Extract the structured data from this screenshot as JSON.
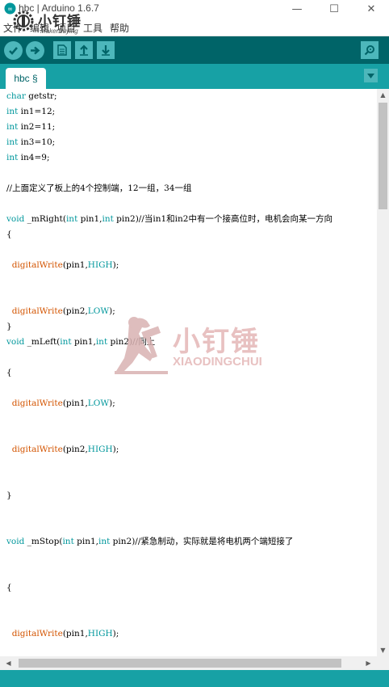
{
  "window": {
    "title": "hbc | Arduino 1.6.7",
    "minimize": "—",
    "maximize": "☐",
    "close": "✕"
  },
  "menu": [
    "文件",
    "编辑",
    "项目",
    "工具",
    "帮助"
  ],
  "logo": {
    "text": "小钉锤",
    "subtitle": "MakerBuying"
  },
  "toolbar": {
    "verify_icon": "check-icon",
    "upload_icon": "arrow-right-icon",
    "new_icon": "new-file-icon",
    "open_icon": "arrow-up-icon",
    "save_icon": "arrow-down-icon",
    "serial_icon": "magnifier-icon"
  },
  "tab": {
    "label": "hbc §"
  },
  "code": [
    {
      "segments": [
        {
          "t": "char",
          "c": "kw"
        },
        {
          "t": " getstr;"
        }
      ]
    },
    {
      "segments": [
        {
          "t": "int",
          "c": "kw"
        },
        {
          "t": " in1=12;"
        }
      ]
    },
    {
      "segments": [
        {
          "t": "int",
          "c": "kw"
        },
        {
          "t": " in2=11;"
        }
      ]
    },
    {
      "segments": [
        {
          "t": "int",
          "c": "kw"
        },
        {
          "t": " in3=10;"
        }
      ]
    },
    {
      "segments": [
        {
          "t": "int",
          "c": "kw"
        },
        {
          "t": " in4=9;"
        }
      ]
    },
    {
      "segments": [
        {
          "t": ""
        }
      ]
    },
    {
      "segments": [
        {
          "t": "//上面定义了板上的4个控制端，12一组，34一组"
        }
      ]
    },
    {
      "segments": [
        {
          "t": ""
        }
      ]
    },
    {
      "segments": [
        {
          "t": "void",
          "c": "kw"
        },
        {
          "t": " _mRight("
        },
        {
          "t": "int",
          "c": "kw"
        },
        {
          "t": " pin1,"
        },
        {
          "t": "int",
          "c": "kw"
        },
        {
          "t": " pin2)//当in1和in2中有一个接高位时，电机会向某一方向"
        }
      ]
    },
    {
      "segments": [
        {
          "t": "{"
        }
      ]
    },
    {
      "segments": [
        {
          "t": ""
        }
      ]
    },
    {
      "segments": [
        {
          "t": "  "
        },
        {
          "t": "digitalWrite",
          "c": "fn"
        },
        {
          "t": "(pin1,"
        },
        {
          "t": "HIGH",
          "c": "kw"
        },
        {
          "t": ");"
        }
      ]
    },
    {
      "segments": [
        {
          "t": ""
        }
      ]
    },
    {
      "segments": [
        {
          "t": ""
        }
      ]
    },
    {
      "segments": [
        {
          "t": "  "
        },
        {
          "t": "digitalWrite",
          "c": "fn"
        },
        {
          "t": "(pin2,"
        },
        {
          "t": "LOW",
          "c": "kw"
        },
        {
          "t": ");"
        }
      ]
    },
    {
      "segments": [
        {
          "t": "}"
        }
      ]
    },
    {
      "segments": [
        {
          "t": "void",
          "c": "kw"
        },
        {
          "t": " _mLeft("
        },
        {
          "t": "int",
          "c": "kw"
        },
        {
          "t": " pin1,"
        },
        {
          "t": "int",
          "c": "kw"
        },
        {
          "t": " pin2)//同上"
        }
      ]
    },
    {
      "segments": [
        {
          "t": ""
        }
      ]
    },
    {
      "segments": [
        {
          "t": "{"
        }
      ]
    },
    {
      "segments": [
        {
          "t": ""
        }
      ]
    },
    {
      "segments": [
        {
          "t": "  "
        },
        {
          "t": "digitalWrite",
          "c": "fn"
        },
        {
          "t": "(pin1,"
        },
        {
          "t": "LOW",
          "c": "kw"
        },
        {
          "t": ");"
        }
      ]
    },
    {
      "segments": [
        {
          "t": ""
        }
      ]
    },
    {
      "segments": [
        {
          "t": ""
        }
      ]
    },
    {
      "segments": [
        {
          "t": "  "
        },
        {
          "t": "digitalWrite",
          "c": "fn"
        },
        {
          "t": "(pin2,"
        },
        {
          "t": "HIGH",
          "c": "kw"
        },
        {
          "t": ");"
        }
      ]
    },
    {
      "segments": [
        {
          "t": ""
        }
      ]
    },
    {
      "segments": [
        {
          "t": ""
        }
      ]
    },
    {
      "segments": [
        {
          "t": "}"
        }
      ]
    },
    {
      "segments": [
        {
          "t": ""
        }
      ]
    },
    {
      "segments": [
        {
          "t": ""
        }
      ]
    },
    {
      "segments": [
        {
          "t": "void",
          "c": "kw"
        },
        {
          "t": " _mStop("
        },
        {
          "t": "int",
          "c": "kw"
        },
        {
          "t": " pin1,"
        },
        {
          "t": "int",
          "c": "kw"
        },
        {
          "t": " pin2)//紧急制动，实际就是将电机两个端短接了"
        }
      ]
    },
    {
      "segments": [
        {
          "t": ""
        }
      ]
    },
    {
      "segments": [
        {
          "t": ""
        }
      ]
    },
    {
      "segments": [
        {
          "t": "{"
        }
      ]
    },
    {
      "segments": [
        {
          "t": ""
        }
      ]
    },
    {
      "segments": [
        {
          "t": ""
        }
      ]
    },
    {
      "segments": [
        {
          "t": "  "
        },
        {
          "t": "digitalWrite",
          "c": "fn"
        },
        {
          "t": "(pin1,"
        },
        {
          "t": "HIGH",
          "c": "kw"
        },
        {
          "t": ");"
        }
      ]
    }
  ],
  "watermark": {
    "text": "小钉锤",
    "subtitle": "XIAODINGCHUI"
  },
  "colors": {
    "toolbar": "#006468",
    "tabbar": "#17a1a5",
    "button": "#4db7bb",
    "keyword": "#00979c",
    "function": "#d35400"
  }
}
